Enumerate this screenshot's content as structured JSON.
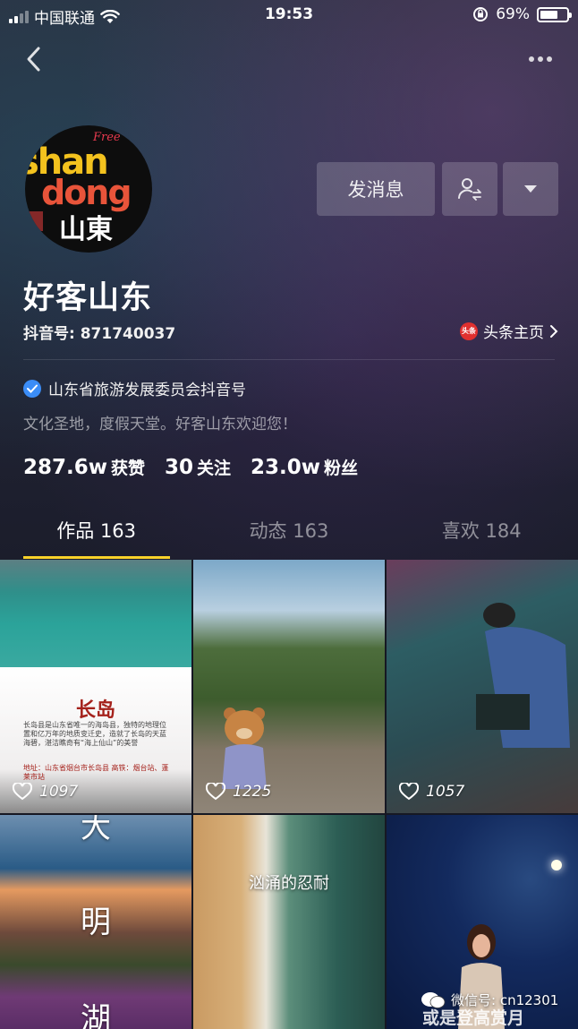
{
  "status_bar": {
    "carrier": "中国联通",
    "time": "19:53",
    "battery_percent": "69%",
    "battery_level": 0.69
  },
  "profile": {
    "avatar": {
      "logo_top": "Free",
      "logo_line1": "shan",
      "logo_line2": "dong",
      "logo_chinese": "山東"
    },
    "message_button": "发消息",
    "nickname": "好客山东",
    "douyin_id": "抖音号: 871740037",
    "toutiao_badge": "头条",
    "toutiao_link": "头条主页",
    "verified_text": "山东省旅游发展委员会抖音号",
    "bio": "文化圣地，度假天堂。好客山东欢迎您！",
    "stats": [
      {
        "num": "287.6w",
        "label": "获赞"
      },
      {
        "num": "30",
        "label": "关注"
      },
      {
        "num": "23.0w",
        "label": "粉丝"
      }
    ]
  },
  "tabs": [
    {
      "label": "作品 163",
      "active": true
    },
    {
      "label": "动态 163",
      "active": false
    },
    {
      "label": "喜欢 184",
      "active": false
    }
  ],
  "videos": [
    {
      "likes": "1097",
      "card_title": "长岛",
      "card_text": "长岛县是山东省唯一的海岛县，独特的地理位置和亿万年的地质变迁史，造就了长岛的天蓝海碧，湛洁瞧奇有“海上仙山”的美誉",
      "card_addr": "地址：山东省烟台市长岛县 高铁：烟台站、蓬莱市站"
    },
    {
      "likes": "1225"
    },
    {
      "likes": "1057"
    },
    {
      "title_chars": [
        "大",
        "明",
        "湖"
      ]
    },
    {
      "caption": "汹涌的忍耐"
    },
    {
      "bottom_text": "或是登高赏月"
    }
  ],
  "watermark": "微信号: cn12301",
  "colors": {
    "background": "#161823",
    "tab_indicator": "#f8d22a",
    "verified_blue": "#3b8df7",
    "toutiao_red": "#e0302f"
  }
}
